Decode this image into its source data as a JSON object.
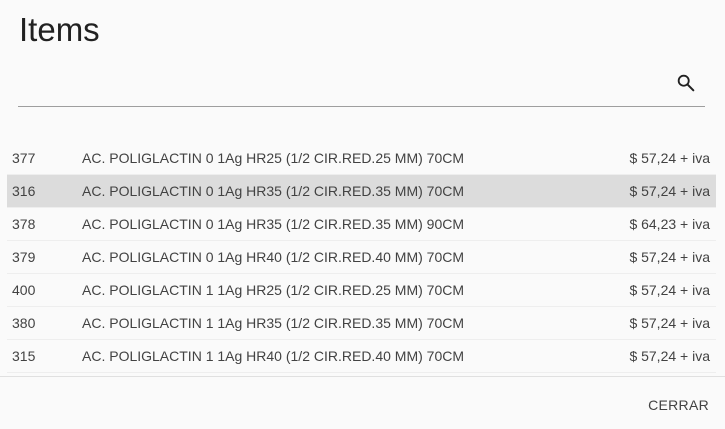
{
  "dialog": {
    "title": "Items",
    "search": {
      "value": "",
      "placeholder": "",
      "icon": "search-icon"
    },
    "items": [
      {
        "code": "377",
        "description": "AC. POLIGLACTIN 0 1Ag HR25 (1/2 CIR.RED.25 MM) 70CM",
        "price": "$ 57,24 + iva",
        "selected": false
      },
      {
        "code": "316",
        "description": "AC. POLIGLACTIN 0 1Ag HR35 (1/2 CIR.RED.35 MM) 70CM",
        "price": "$ 57,24 + iva",
        "selected": true
      },
      {
        "code": "378",
        "description": "AC. POLIGLACTIN 0 1Ag HR35 (1/2 CIR.RED.35 MM) 90CM",
        "price": "$ 64,23 + iva",
        "selected": false
      },
      {
        "code": "379",
        "description": "AC. POLIGLACTIN 0 1Ag HR40 (1/2 CIR.RED.40 MM) 70CM",
        "price": "$ 57,24 + iva",
        "selected": false
      },
      {
        "code": "400",
        "description": "AC. POLIGLACTIN 1 1Ag HR25 (1/2 CIR.RED.25 MM) 70CM",
        "price": "$ 57,24 + iva",
        "selected": false
      },
      {
        "code": "380",
        "description": "AC. POLIGLACTIN 1 1Ag HR35 (1/2 CIR.RED.35 MM) 70CM",
        "price": "$ 57,24 + iva",
        "selected": false
      },
      {
        "code": "315",
        "description": "AC. POLIGLACTIN 1 1Ag HR40 (1/2 CIR.RED.40 MM) 70CM",
        "price": "$ 57,24 + iva",
        "selected": false
      }
    ],
    "close_label": "CERRAR"
  },
  "colors": {
    "background": "#fafafa",
    "selected_row": "#dcdcdc",
    "text": "#424242"
  }
}
